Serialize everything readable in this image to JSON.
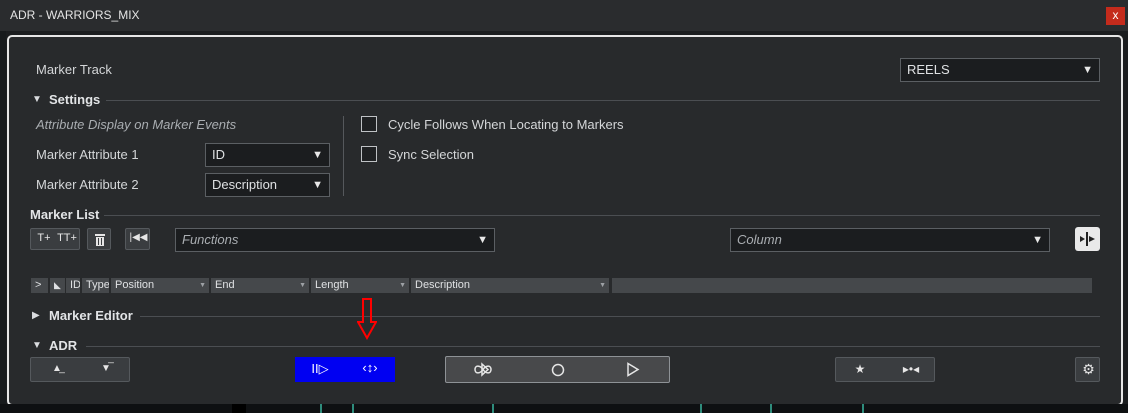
{
  "window": {
    "title": "ADR - WARRIORS_MIX",
    "close_label": "x"
  },
  "marker_track": {
    "label": "Marker Track",
    "value": "REELS"
  },
  "settings": {
    "title": "Settings",
    "attribute_display": "Attribute Display on Marker Events",
    "attr1_label": "Marker Attribute 1",
    "attr1_value": "ID",
    "attr2_label": "Marker Attribute 2",
    "attr2_value": "Description",
    "cycle_follows": "Cycle Follows When Locating to Markers",
    "sync_selection": "Sync Selection"
  },
  "marker_list": {
    "title": "Marker List",
    "functions_placeholder": "Functions",
    "column_placeholder": "Column",
    "columns": [
      ">",
      "",
      "ID",
      "Type",
      "Position",
      "End",
      "Length",
      "Description"
    ]
  },
  "marker_editor": {
    "title": "Marker Editor"
  },
  "adr": {
    "title": "ADR"
  },
  "colors": {
    "accent_blue": "#0000f2",
    "annotation_red": "#ff0000",
    "close_red": "#c42b1c"
  },
  "icons": [
    "add-marker-icon",
    "add-multi-marker-icon",
    "delete-icon",
    "go-to-start-icon",
    "swap-panel-icon",
    "move-up-icon",
    "move-down-icon",
    "insert-icon",
    "trim-icon",
    "cycle-icon",
    "record-icon",
    "play-icon",
    "star-icon",
    "snap-icon",
    "gear-icon",
    "annotation-down-arrow-icon"
  ]
}
